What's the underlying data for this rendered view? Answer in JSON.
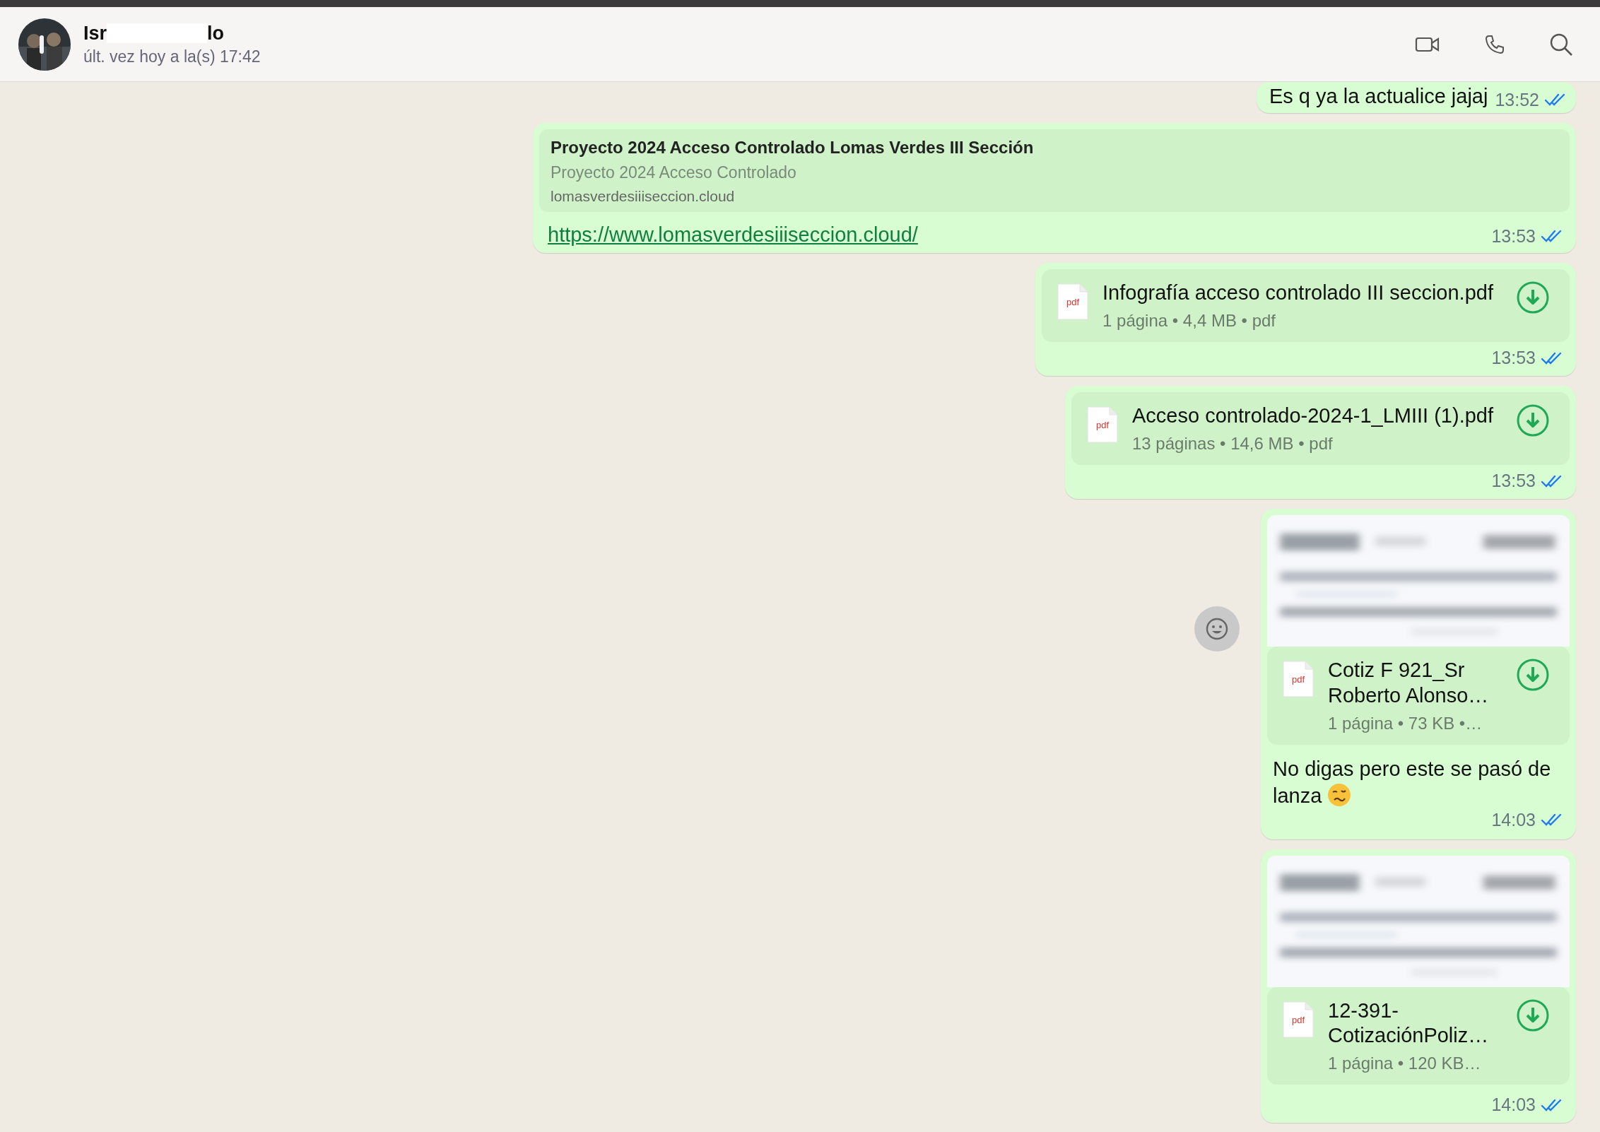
{
  "header": {
    "name_start": "Isr",
    "name_end": "lo",
    "status": "últ. vez hoy a la(s) 17:42"
  },
  "messages": [
    {
      "kind": "text",
      "text": "Es q ya la actualice jajaj",
      "time": "13:52",
      "read": true
    },
    {
      "kind": "link",
      "preview": {
        "title": "Proyecto 2024 Acceso Controlado Lomas Verdes III Sección",
        "description": "Proyecto 2024 Acceso Controlado",
        "domain": "lomasverdesiiiseccion.cloud"
      },
      "url": "https://www.lomasverdesiiiseccion.cloud/",
      "time": "13:53",
      "read": true
    },
    {
      "kind": "file",
      "file": {
        "type": "pdf",
        "name_lines": [
          "Infografía acceso controlado III seccion.pdf"
        ],
        "meta": "1 página • 4,4 MB • pdf"
      },
      "time": "13:53",
      "read": true
    },
    {
      "kind": "file",
      "file": {
        "type": "pdf",
        "name_lines": [
          "Acceso controlado-2024-1_LMIII (1).pdf"
        ],
        "meta": "13 páginas • 14,6 MB • pdf"
      },
      "time": "13:53",
      "read": true
    },
    {
      "kind": "document",
      "file": {
        "type": "pdf",
        "name_lines": [
          "Cotiz F 921_Sr",
          "Roberto Alonso…"
        ],
        "meta": "1 página • 73 KB •…"
      },
      "caption": "No digas pero este se pasó de lanza",
      "reaction_button": true,
      "time": "14:03",
      "read": true
    },
    {
      "kind": "document",
      "file": {
        "type": "pdf",
        "name_lines": [
          "12-391-",
          "CotizaciónPoliz…"
        ],
        "meta": "1 página • 120 KB…"
      },
      "reaction_button": false,
      "time": "14:03",
      "read": true
    }
  ]
}
